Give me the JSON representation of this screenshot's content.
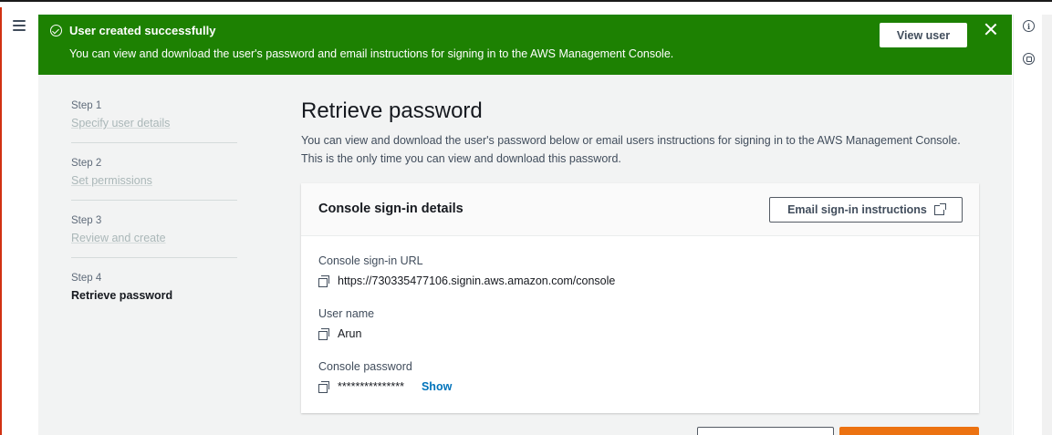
{
  "flash": {
    "title": "User created successfully",
    "message": "You can view and download the user's password and email instructions for signing in to the AWS Management Console.",
    "view_user_label": "View user",
    "colors": {
      "background": "#1d8102",
      "text": "#ffffff"
    }
  },
  "right_rail": {
    "info_glyph": "i",
    "icons": [
      "info-icon",
      "feedback-icon"
    ]
  },
  "steps": [
    {
      "number": "Step 1",
      "label": "Specify user details",
      "active": false
    },
    {
      "number": "Step 2",
      "label": "Set permissions",
      "active": false
    },
    {
      "number": "Step 3",
      "label": "Review and create",
      "active": false
    },
    {
      "number": "Step 4",
      "label": "Retrieve password",
      "active": true
    }
  ],
  "main": {
    "title": "Retrieve password",
    "description_line1": "You can view and download the user's password below or email users instructions for signing in to the AWS Management Console.",
    "description_line2": "This is the only time you can view and download this password."
  },
  "card": {
    "title": "Console sign-in details",
    "email_button_label": "Email sign-in instructions",
    "sign_in_url_label": "Console sign-in URL",
    "sign_in_url": "https://730335477106.signin.aws.amazon.com/console",
    "user_name_label": "User name",
    "user_name": "Arun",
    "password_label": "Console password",
    "password_masked": "***************",
    "show_label": "Show"
  },
  "colors": {
    "primary_button": "#ec7211",
    "link": "#0073bb",
    "content_background": "#f2f3f3"
  }
}
